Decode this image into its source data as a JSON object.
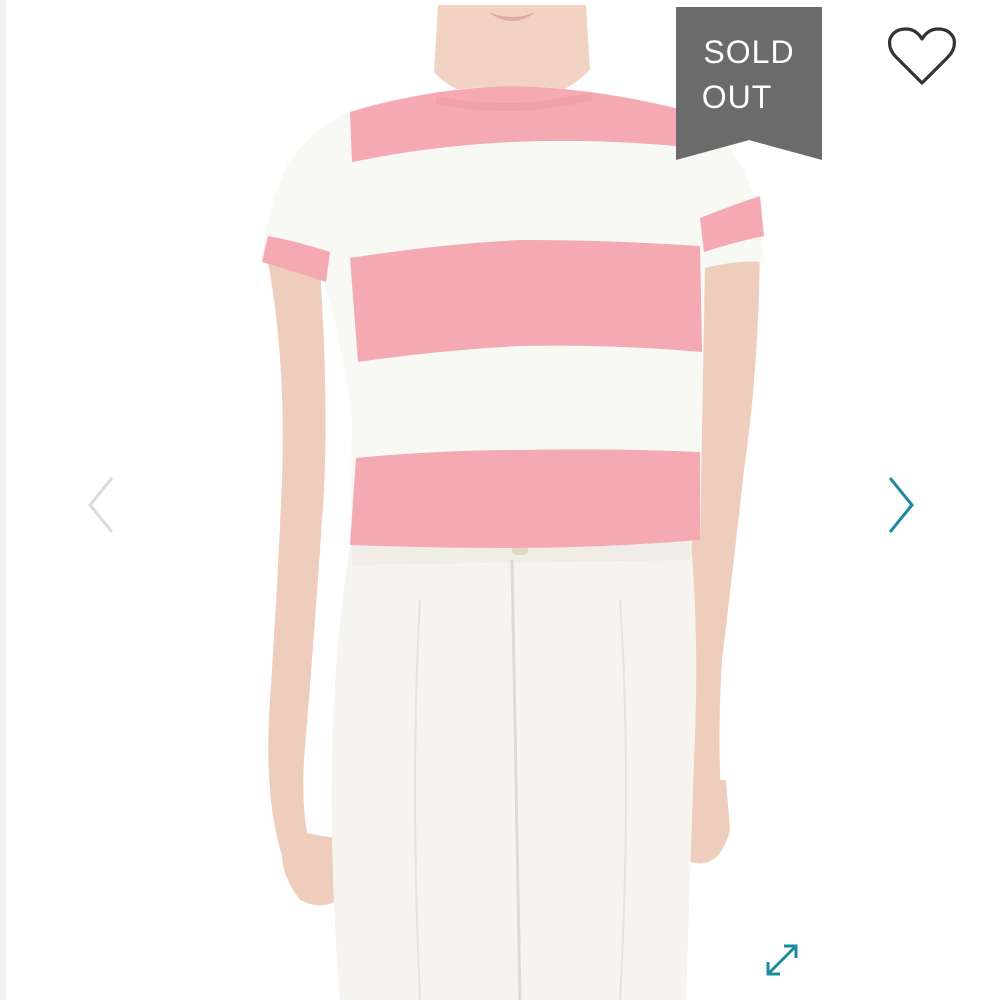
{
  "product_image": {
    "alt": "",
    "colors": {
      "stripe_pink": "#f4a9b3",
      "stripe_white": "#f8f8f4",
      "skin": "#f1d2c3",
      "pants": "#f6f4ee"
    }
  },
  "badge": {
    "line1": "SOLD",
    "line2": "OUT",
    "color": "#6b6b6b"
  },
  "controls": {
    "favorite_icon": "heart-outline-icon",
    "prev_icon": "chevron-left-icon",
    "next_icon": "chevron-right-icon",
    "expand_icon": "expand-arrows-icon",
    "accent_color": "#1b8a9c"
  }
}
